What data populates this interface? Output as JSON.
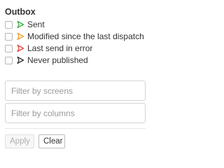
{
  "panel": {
    "title": "Outbox"
  },
  "options": [
    {
      "label": "Sent",
      "icon": "green-flag-icon",
      "color": "#3cb043",
      "checked": false
    },
    {
      "label": "Modified since the last dispatch",
      "icon": "orange-flag-icon",
      "color": "#f0a030",
      "checked": false
    },
    {
      "label": "Last send in error",
      "icon": "red-flag-icon",
      "color": "#e8453c",
      "checked": false
    },
    {
      "label": "Never published",
      "icon": "black-flag-icon",
      "color": "#333333",
      "checked": false
    }
  ],
  "filters": {
    "screens_placeholder": "Filter by screens",
    "columns_placeholder": "Filter by columns"
  },
  "actions": {
    "apply_label": "Apply",
    "apply_disabled": true,
    "clear_label": "Clear"
  }
}
